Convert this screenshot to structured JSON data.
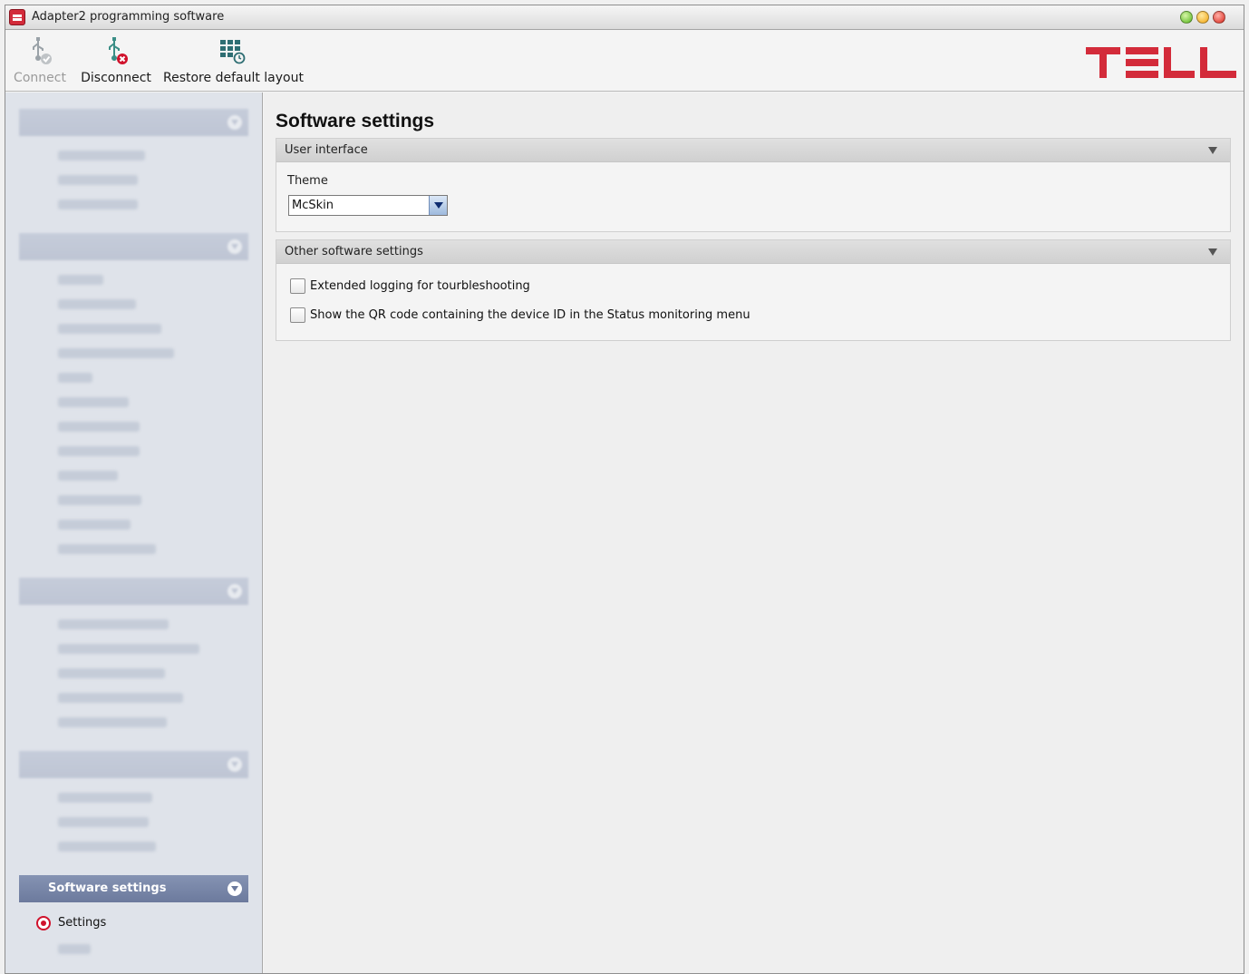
{
  "window": {
    "title": "Adapter2 programming software"
  },
  "toolbar": {
    "connect_label": "Connect",
    "disconnect_label": "Disconnect",
    "restore_label": "Restore default layout",
    "logo_text": "TELL"
  },
  "sidebar": {
    "active_group": {
      "label": "Software settings",
      "items": [
        {
          "label": "Settings",
          "selected": true
        }
      ]
    }
  },
  "main": {
    "page_title": "Software settings",
    "user_interface": {
      "title": "User interface",
      "theme_label": "Theme",
      "theme_value": "McSkin"
    },
    "other_settings": {
      "title": "Other software settings",
      "options": [
        {
          "label": "Extended logging for tourbleshooting",
          "checked": false
        },
        {
          "label": "Show the QR code containing the device ID in the Status monitoring menu",
          "checked": false
        }
      ]
    }
  },
  "colors": {
    "accent_red": "#d0122c",
    "sidebar_header": "#6c7a9d",
    "logo_red": "#d32b3a"
  }
}
